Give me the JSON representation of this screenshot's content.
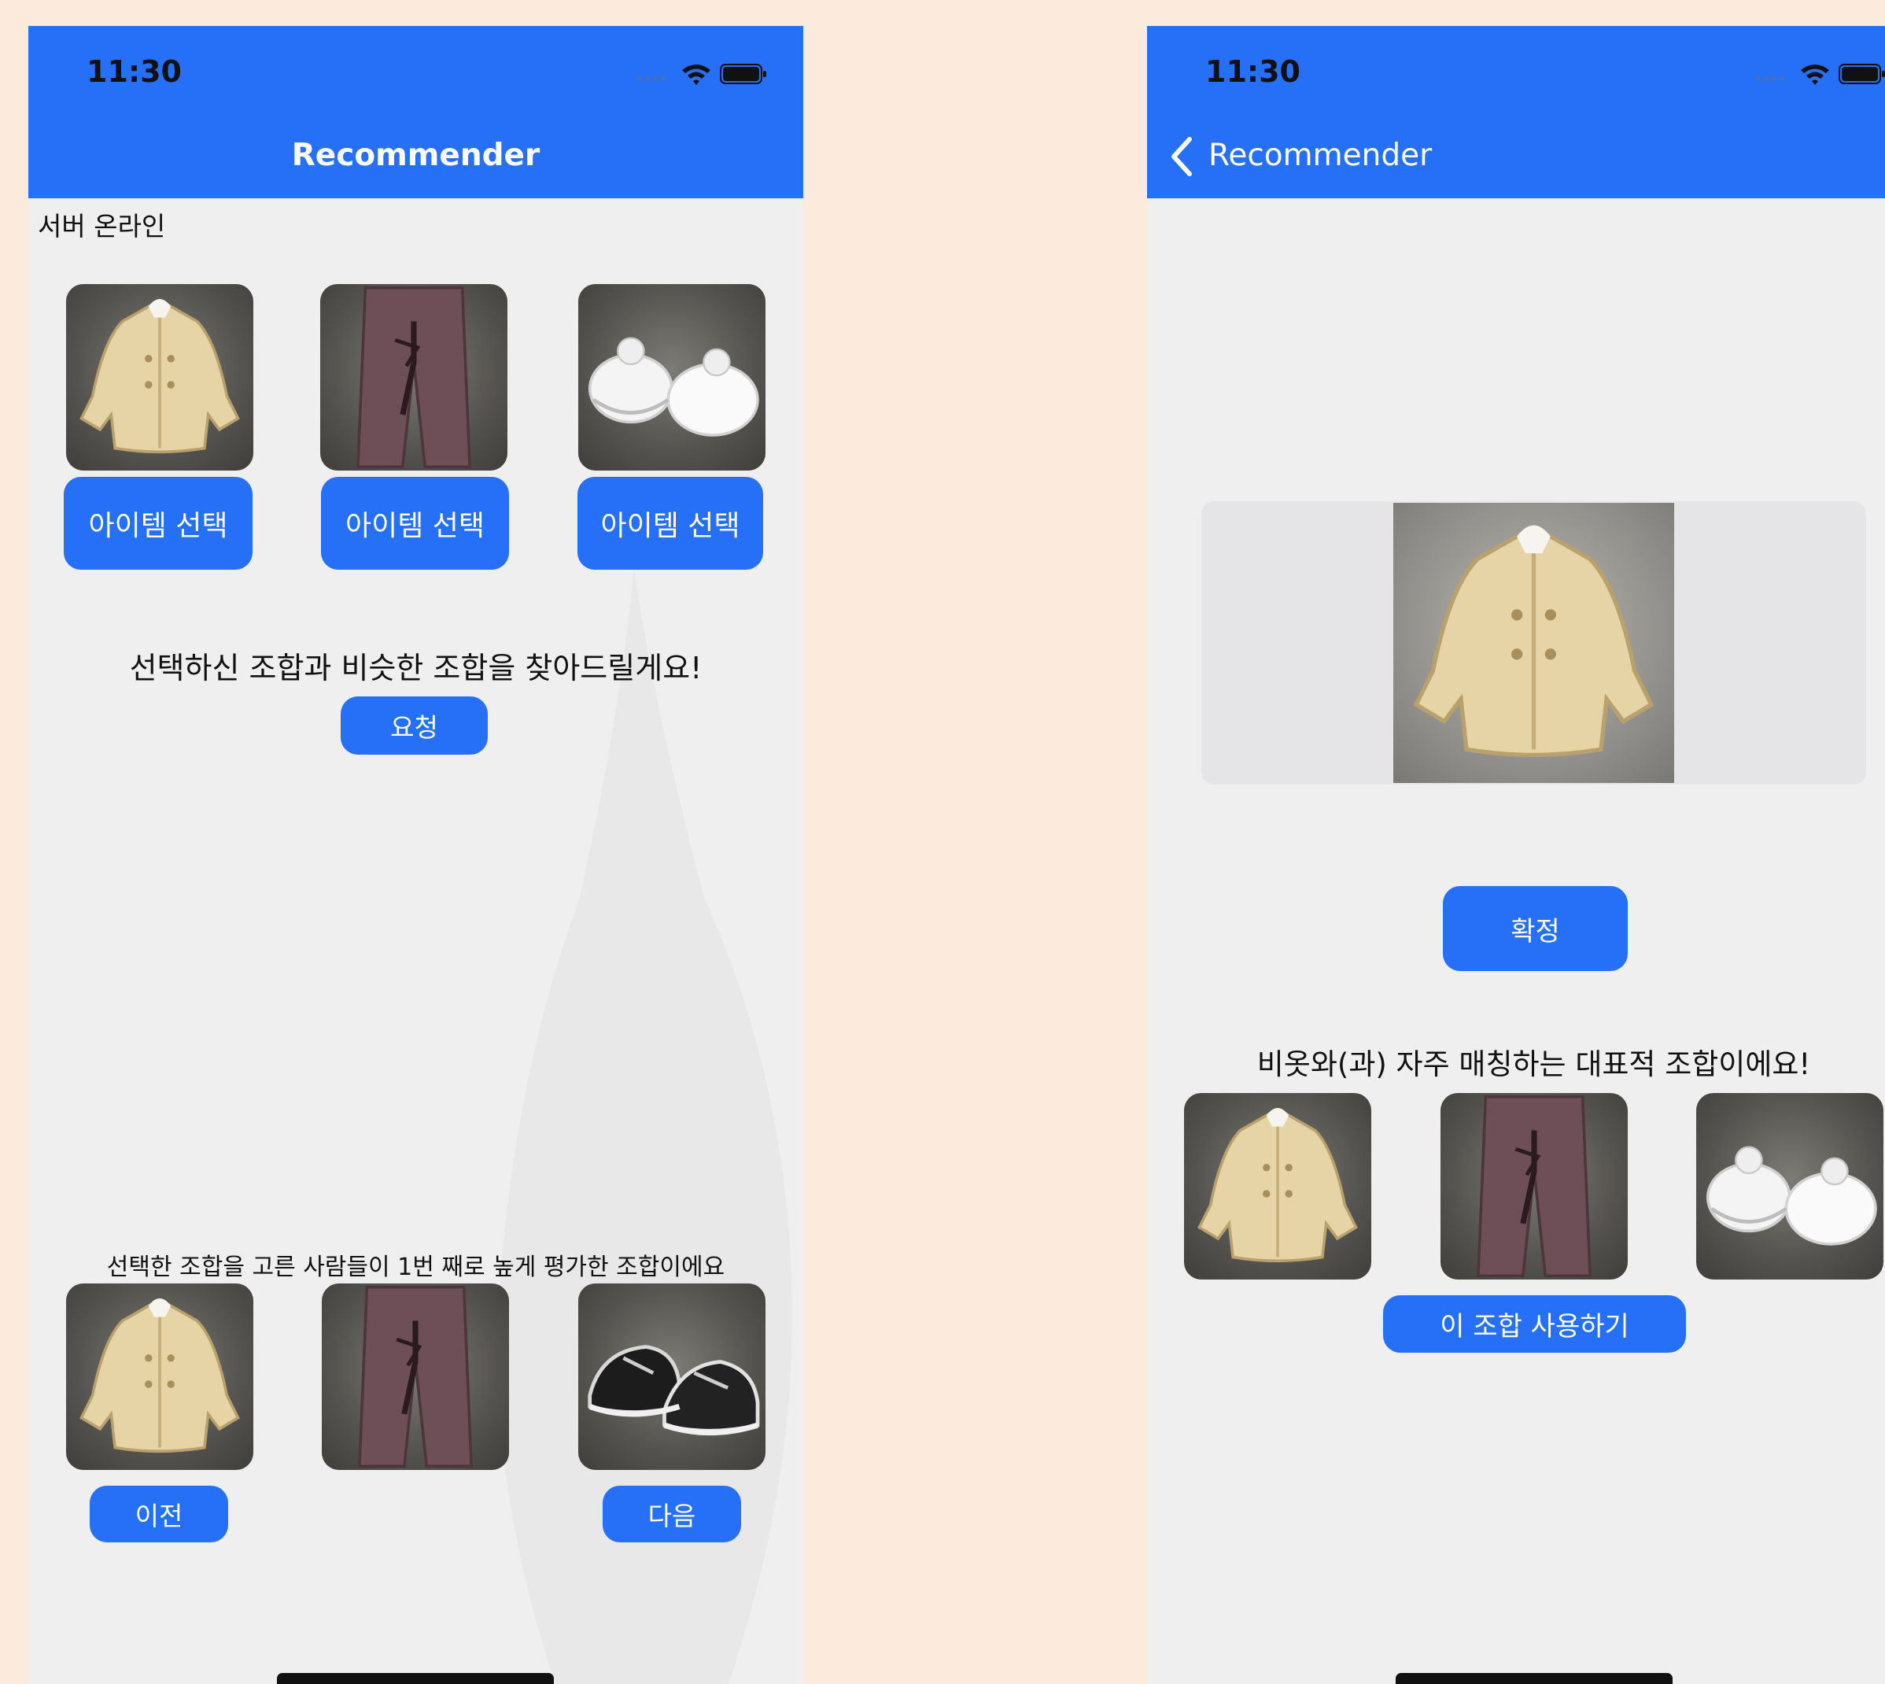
{
  "status": {
    "time": "11:30"
  },
  "left_screen": {
    "nav_title": "Recommender",
    "server_status": "서버 온라인",
    "select_button_label": "아이템 선택",
    "selected_items": [
      {
        "icon": "jacket-icon"
      },
      {
        "icon": "pants-icon"
      },
      {
        "icon": "white-shoes-icon"
      }
    ],
    "prompt": "선택하신 조합과 비슷한 조합을 찾아드릴게요!",
    "request_button": "요청",
    "result_caption": "선택한 조합을 고른 사람들이 1번 째로 높게 평가한 조합이에요",
    "result_items": [
      {
        "icon": "jacket-icon"
      },
      {
        "icon": "pants-icon"
      },
      {
        "icon": "black-sneakers-icon"
      }
    ],
    "prev_button": "이전",
    "next_button": "다음"
  },
  "right_screen": {
    "back_title": "Recommender",
    "confirm_button": "확정",
    "caption": "비옷와(과) 자주 매칭하는 대표적 조합이에요!",
    "combo_items": [
      {
        "icon": "jacket-icon"
      },
      {
        "icon": "pants-icon"
      },
      {
        "icon": "white-shoes-icon"
      }
    ],
    "use_combo_button": "이 조합 사용하기"
  },
  "colors": {
    "accent": "#2670f8",
    "page_background": "#fcebdc",
    "screen_background": "#efefef"
  }
}
